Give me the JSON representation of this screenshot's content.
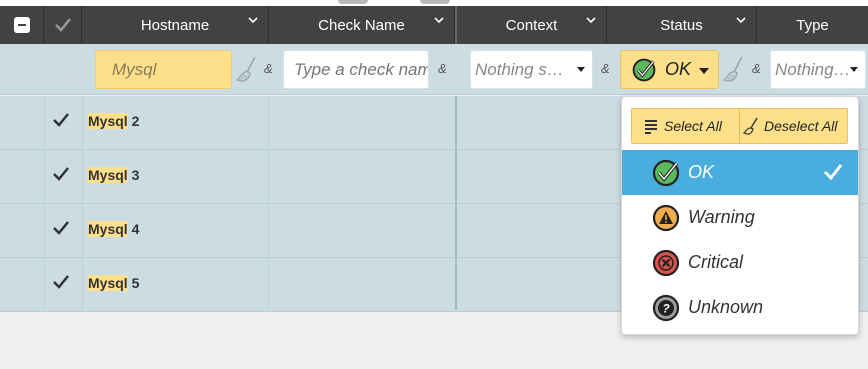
{
  "header": {
    "columns": [
      {
        "label": ""
      },
      {
        "label": ""
      },
      {
        "label": "Hostname"
      },
      {
        "label": "Check Name"
      },
      {
        "label": "Context"
      },
      {
        "label": "Status"
      },
      {
        "label": "Type"
      }
    ]
  },
  "filters": {
    "hostname_value": "Mysql",
    "check_name_placeholder": "Type a check name",
    "context_value": "Nothing selected",
    "status_value": "OK",
    "type_value": "Nothing selected",
    "amp": "&"
  },
  "rows": [
    {
      "host_match": "Mysql",
      "host_rest": " 2"
    },
    {
      "host_match": "Mysql",
      "host_rest": " 3"
    },
    {
      "host_match": "Mysql",
      "host_rest": " 4"
    },
    {
      "host_match": "Mysql",
      "host_rest": " 5"
    }
  ],
  "status_dropdown": {
    "select_all": "Select All",
    "deselect_all": "Deselect All",
    "options": [
      {
        "label": "OK",
        "icon": "ok-icon",
        "selected": true
      },
      {
        "label": "Warning",
        "icon": "warning-icon",
        "selected": false
      },
      {
        "label": "Critical",
        "icon": "critical-icon",
        "selected": false
      },
      {
        "label": "Unknown",
        "icon": "unknown-icon",
        "selected": false
      }
    ]
  },
  "colors": {
    "header_bg": "#424242",
    "row_bg": "#cbdde3",
    "highlight": "#ffe08a",
    "active_option": "#49aede",
    "ok_green": "#5cb85c",
    "warning_orange": "#f0ad4e",
    "critical_red": "#d9534f",
    "unknown_gray": "#9e9e9e"
  }
}
